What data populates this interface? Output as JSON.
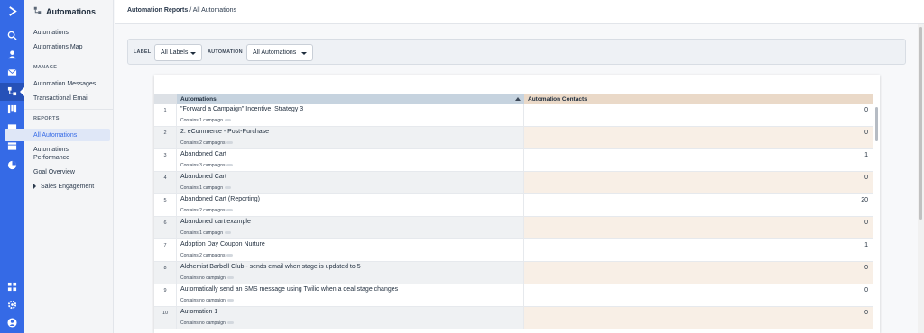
{
  "app": {
    "brand_color": "#356ae6",
    "section_title": "Automations"
  },
  "rail": {
    "icons": [
      "logo-chevron-icon",
      "search-icon",
      "contacts-icon",
      "campaigns-icon",
      "automations-icon",
      "deals-icon",
      "conversations-icon",
      "websites-icon",
      "reports-icon",
      "apps-icon",
      "settings-icon",
      "user-avatar-icon"
    ]
  },
  "sidebar": {
    "title": "Automations",
    "links_top": [
      "Automations",
      "Automations Map"
    ],
    "manage_heading": "MANAGE",
    "manage_links": [
      "Automation Messages",
      "Transactional Email"
    ],
    "reports_heading": "REPORTS",
    "reports_links": [
      "All Automations",
      "Automations Performance",
      "Goal Overview"
    ],
    "sales_engagement": "Sales Engagement"
  },
  "breadcrumb": {
    "parent": "Automation Reports",
    "separator": " / ",
    "current": "All Automations"
  },
  "filters": {
    "label_caption": "LABEL",
    "label_value": "All Labels",
    "automation_caption": "AUTOMATION",
    "automation_value": "All Automations"
  },
  "table": {
    "headers": {
      "automations": "Automations",
      "contacts": "Automation Contacts"
    },
    "rows": [
      {
        "num": "1",
        "name": "\"Forward a Campaign\" Incentive_Strategy 3",
        "sub": "Contains 1 campaign",
        "value": "0"
      },
      {
        "num": "2",
        "name": "2. eCommerce - Post-Purchase",
        "sub": "Contains 2 campaigns",
        "value": "0"
      },
      {
        "num": "3",
        "name": "Abandoned Cart",
        "sub": "Contains 3 campaigns",
        "value": "1"
      },
      {
        "num": "4",
        "name": "Abandoned Cart",
        "sub": "Contains 1 campaign",
        "value": "0"
      },
      {
        "num": "5",
        "name": "Abandoned Cart (Reporting)",
        "sub": "Contains 2 campaigns",
        "value": "20"
      },
      {
        "num": "6",
        "name": "Abandoned cart example",
        "sub": "Contains 1 campaign",
        "value": "0"
      },
      {
        "num": "7",
        "name": "Adoption Day Coupon Nurture",
        "sub": "Contains 2 campaigns",
        "value": "1"
      },
      {
        "num": "8",
        "name": "Alchemist Barbell Club - sends email when stage is updated to 5",
        "sub": "Contains no campaign",
        "value": "0"
      },
      {
        "num": "9",
        "name": "Automatically send an SMS message using Twilio when a deal stage changes",
        "sub": "Contains no campaign",
        "value": "0"
      },
      {
        "num": "10",
        "name": "Automation 1",
        "sub": "Contains no campaign",
        "value": "0"
      }
    ]
  }
}
